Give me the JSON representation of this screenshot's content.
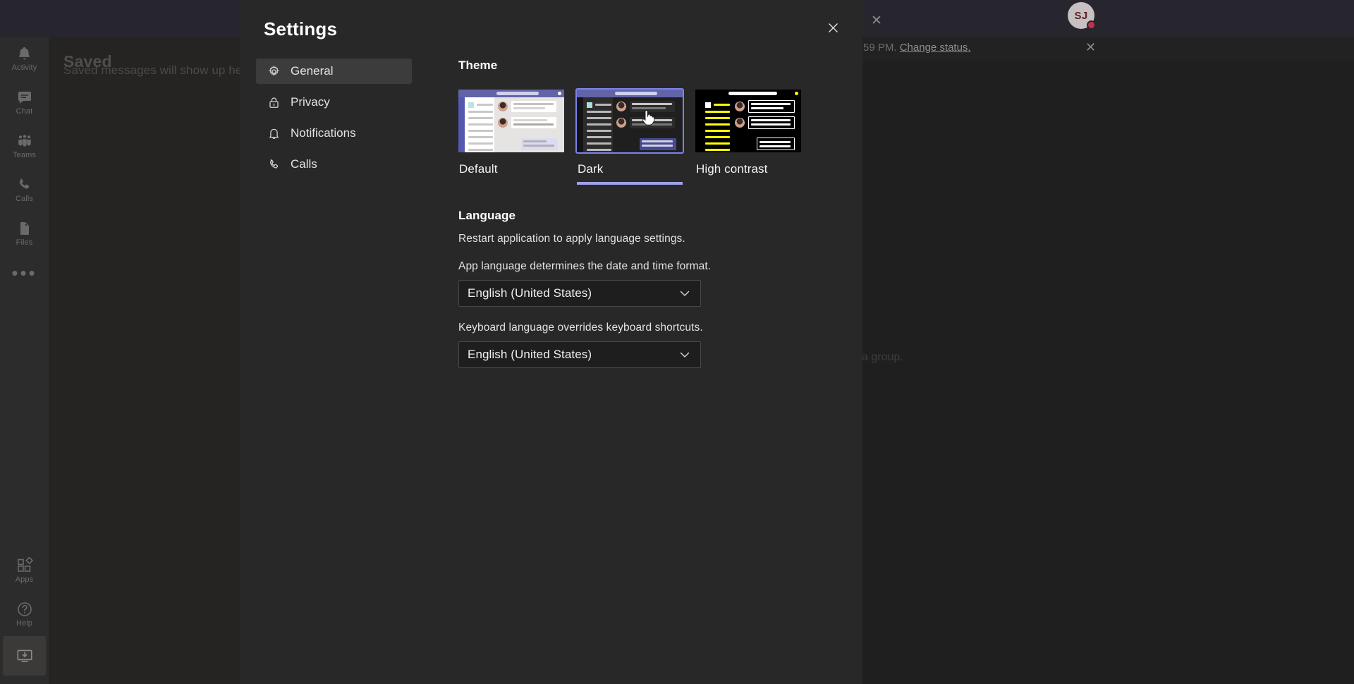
{
  "background": {
    "saved_title": "Saved",
    "saved_subtitle": "Saved messages will show up here",
    "group_text": "a group.",
    "status_text_prefix": "59 PM.",
    "status_link": "Change status.",
    "avatar_initials": "SJ",
    "close_icon": "close-icon",
    "rail": {
      "items": [
        {
          "label": "Activity",
          "icon": "bell-icon"
        },
        {
          "label": "Chat",
          "icon": "chat-icon"
        },
        {
          "label": "Teams",
          "icon": "teams-icon"
        },
        {
          "label": "Calls",
          "icon": "phone-icon"
        },
        {
          "label": "Files",
          "icon": "file-icon"
        }
      ],
      "more_icon": "ellipsis-icon",
      "bottom_items": [
        {
          "label": "Apps",
          "icon": "apps-icon"
        },
        {
          "label": "Help",
          "icon": "help-icon"
        }
      ],
      "download_icon": "download-desktop-icon"
    }
  },
  "modal": {
    "title": "Settings",
    "close_icon": "close-icon",
    "nav": [
      {
        "label": "General",
        "icon": "gear-icon",
        "selected": true
      },
      {
        "label": "Privacy",
        "icon": "lock-icon",
        "selected": false
      },
      {
        "label": "Notifications",
        "icon": "bell-icon",
        "selected": false
      },
      {
        "label": "Calls",
        "icon": "phone-icon",
        "selected": false
      }
    ],
    "theme": {
      "heading": "Theme",
      "options": [
        {
          "label": "Default",
          "selected": false
        },
        {
          "label": "Dark",
          "selected": true
        },
        {
          "label": "High contrast",
          "selected": false
        }
      ],
      "accent_color": "#7b83eb",
      "underline_color": "#9ea2e8"
    },
    "language": {
      "heading": "Language",
      "restart_note": "Restart application to apply language settings.",
      "app_language_label": "App language determines the date and time format.",
      "app_language_value": "English (United States)",
      "keyboard_language_label": "Keyboard language overrides keyboard shortcuts.",
      "keyboard_language_value": "English (United States)",
      "chevron_icon": "chevron-down-icon"
    }
  }
}
